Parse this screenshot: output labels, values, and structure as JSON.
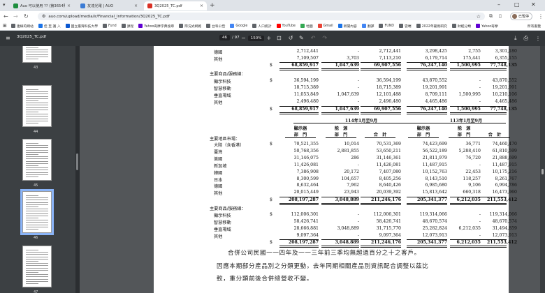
{
  "tabs": [
    {
      "label": "Auo 可以使用 ?? (第3654則)",
      "color": "#1e8e3e"
    },
    {
      "label": "友達光電 | AUO",
      "color": "#3a7bd5"
    },
    {
      "label": "3Q2025_TC.pdf",
      "color": "#d93025"
    }
  ],
  "address": {
    "url": "auo.com/upload/media/ir/Financial_Information/3Q2025_TC.pdf"
  },
  "profile": {
    "label": "已暫停"
  },
  "bookmarks": [
    {
      "label": "連線的網站",
      "color": "#5f6368"
    },
    {
      "label": "佳 至 護 入",
      "color": "#1a73e8"
    },
    {
      "label": "國立臺灣科技大學",
      "color": "#0b57d0"
    },
    {
      "label": "Fund",
      "color": "#5f6368"
    },
    {
      "label": "課程",
      "color": "#5f6368"
    },
    {
      "label": "Yahoo奇摩字典搜尋",
      "color": "#6001d2"
    },
    {
      "label": "際況式網路",
      "color": "#5f6368"
    },
    {
      "label": "台科公告",
      "color": "#5f6368"
    },
    {
      "label": "Google",
      "color": "#4285f4"
    },
    {
      "label": "人口統計",
      "color": "#5f6368"
    },
    {
      "label": "YouTube",
      "color": "#ff0000"
    },
    {
      "label": "地圖",
      "color": "#34a853"
    },
    {
      "label": "Gmail",
      "color": "#ea4335"
    },
    {
      "label": "新聞內容",
      "color": "#1a73e8"
    },
    {
      "label": "翻譯",
      "color": "#4285f4"
    },
    {
      "label": "FUND",
      "color": "#5f6368"
    },
    {
      "label": "雲端",
      "color": "#5f6368"
    },
    {
      "label": "2022年暑假研究",
      "color": "#5f6368"
    },
    {
      "label": "財經分類",
      "color": "#5f6368"
    },
    {
      "label": "Yahoo奇摩",
      "color": "#6001d2"
    }
  ],
  "bookmarks_all": "所有書籤",
  "pdf": {
    "filename": "3Q2025_TC.pdf",
    "page_current": "46",
    "page_total": "/ 97",
    "zoom": "150%"
  },
  "thumbnails": [
    {
      "num": "43"
    },
    {
      "num": "44"
    },
    {
      "num": "45"
    },
    {
      "num": "46"
    },
    {
      "num": "47"
    }
  ],
  "table_top": [
    {
      "label": "德國",
      "c1": "2,712,441",
      "c2": "-",
      "c3": "2,712,441",
      "c4": "3,298,425",
      "c5": "2,755",
      "c6": "3,301,180"
    },
    {
      "label": "其他",
      "c1": "7,109,507",
      "c2": "3,703",
      "c3": "7,113,210",
      "c4": "6,179,714",
      "c5": "175,441",
      "c6": "6,355,155"
    },
    {
      "label": "",
      "dol": "$",
      "c1": "68,859,917",
      "c2": "1,047,639",
      "c3": "69,907,556",
      "c4": "76,247,140",
      "c5": "1,500,995",
      "c6": "77,748,135",
      "total": true
    },
    {
      "label": "主要商品/服務線：",
      "section": true
    },
    {
      "label": "顯示科技",
      "dol": "$",
      "c1": "36,594,199",
      "c2": "-",
      "c3": "36,594,199",
      "c4": "43,870,552",
      "c5": "-",
      "c6": "43,870,552"
    },
    {
      "label": "智慧移動",
      "c1": "18,715,389",
      "c2": "-",
      "c3": "18,715,389",
      "c4": "19,201,991",
      "c5": "-",
      "c6": "19,201,991"
    },
    {
      "label": "垂直場域",
      "c1": "11,053,849",
      "c2": "1,047,639",
      "c3": "12,101,488",
      "c4": "8,709,111",
      "c5": "1,500,995",
      "c6": "10,210,106"
    },
    {
      "label": "其他",
      "c1": "2,496,480",
      "c2": "-",
      "c3": "2,496,480",
      "c4": "4,465,486",
      "c5": "-",
      "c6": "4,465,486"
    },
    {
      "label": "",
      "dol": "$",
      "c1": "68,859,917",
      "c2": "1,047,639",
      "c3": "69,907,556",
      "c4": "76,247,140",
      "c5": "1,500,995",
      "c6": "77,748,135",
      "total": true
    }
  ],
  "period_headers": {
    "left": "114年1月至9月",
    "right": "113年1月至9月"
  },
  "col_headers": [
    {
      "l1": "顯示器",
      "l2": "部　門"
    },
    {
      "l1": "能　源",
      "l2": "部　門"
    },
    {
      "l1": "",
      "l2": "合　計"
    },
    {
      "l1": "顯示器",
      "l2": "部　門"
    },
    {
      "l1": "能　源",
      "l2": "部　門"
    },
    {
      "l1": "",
      "l2": "合　計"
    }
  ],
  "table_bottom": [
    {
      "label": "主要地區市場：",
      "section": true
    },
    {
      "label": "大陸（含香港）",
      "dol": "$",
      "c1": "70,521,355",
      "c2": "10,014",
      "c3": "70,531,369",
      "c4": "74,423,699",
      "c5": "36,771",
      "c6": "74,460,470"
    },
    {
      "label": "臺灣",
      "c1": "50,768,356",
      "c2": "2,881,855",
      "c3": "53,650,211",
      "c4": "56,522,189",
      "c5": "5,288,410",
      "c6": "61,810,599"
    },
    {
      "label": "美國",
      "c1": "31,146,075",
      "c2": "286",
      "c3": "31,146,361",
      "c4": "21,811,979",
      "c5": "76,720",
      "c6": "21,888,699"
    },
    {
      "label": "新加坡",
      "c1": "11,426,081",
      "c2": "-",
      "c3": "11,426,081",
      "c4": "11,487,915",
      "c5": "-",
      "c6": "11,487,915"
    },
    {
      "label": "韓國",
      "c1": "7,386,908",
      "c2": "20,172",
      "c3": "7,407,080",
      "c4": "10,152,763",
      "c5": "22,453",
      "c6": "10,175,216"
    },
    {
      "label": "日本",
      "c1": "8,300,599",
      "c2": "104,657",
      "c3": "8,405,256",
      "c4": "8,143,510",
      "c5": "118,257",
      "c6": "8,261,767"
    },
    {
      "label": "德國",
      "c1": "8,632,464",
      "c2": "7,962",
      "c3": "8,640,426",
      "c4": "6,985,680",
      "c5": "9,106",
      "c6": "6,994,786"
    },
    {
      "label": "其他",
      "c1": "20,015,449",
      "c2": "23,943",
      "c3": "20,039,392",
      "c4": "15,813,642",
      "c5": "660,318",
      "c6": "16,473,960"
    },
    {
      "label": "",
      "dol": "$",
      "c1": "208,197,287",
      "c2": "3,048,889",
      "c3": "211,246,176",
      "c4": "205,341,377",
      "c5": "6,212,035",
      "c6": "211,553,412",
      "total": true
    },
    {
      "label": "主要商品/服務線：",
      "section": true
    },
    {
      "label": "顯示科技",
      "dol": "$",
      "c1": "112,006,301",
      "c2": "-",
      "c3": "112,006,301",
      "c4": "119,314,066",
      "c5": "-",
      "c6": "119,314,066"
    },
    {
      "label": "智慧移動",
      "c1": "58,426,741",
      "c2": "-",
      "c3": "58,426,741",
      "c4": "48,670,574",
      "c5": "-",
      "c6": "48,670,574"
    },
    {
      "label": "垂直場域",
      "c1": "28,666,881",
      "c2": "3,048,889",
      "c3": "31,715,770",
      "c4": "25,282,824",
      "c5": "6,212,035",
      "c6": "31,494,859"
    },
    {
      "label": "其他",
      "c1": "9,097,364",
      "c2": "-",
      "c3": "9,097,364",
      "c4": "12,073,913",
      "c5": "-",
      "c6": "12,073,913"
    },
    {
      "label": "",
      "dol": "$",
      "c1": "208,197,287",
      "c2": "3,048,889",
      "c3": "211,246,176",
      "c4": "205,341,377",
      "c5": "6,212,035",
      "c6": "211,553,412",
      "total": true
    }
  ],
  "notes": [
    "合併公司民國一一四年及一一三年前三季均無超過百分之十之客戶。",
    "因應本期部分產品別之分類更動，去年同期相關產品別資訊配合調整以茲比",
    "較，重分類前後合併總營收不變。"
  ]
}
